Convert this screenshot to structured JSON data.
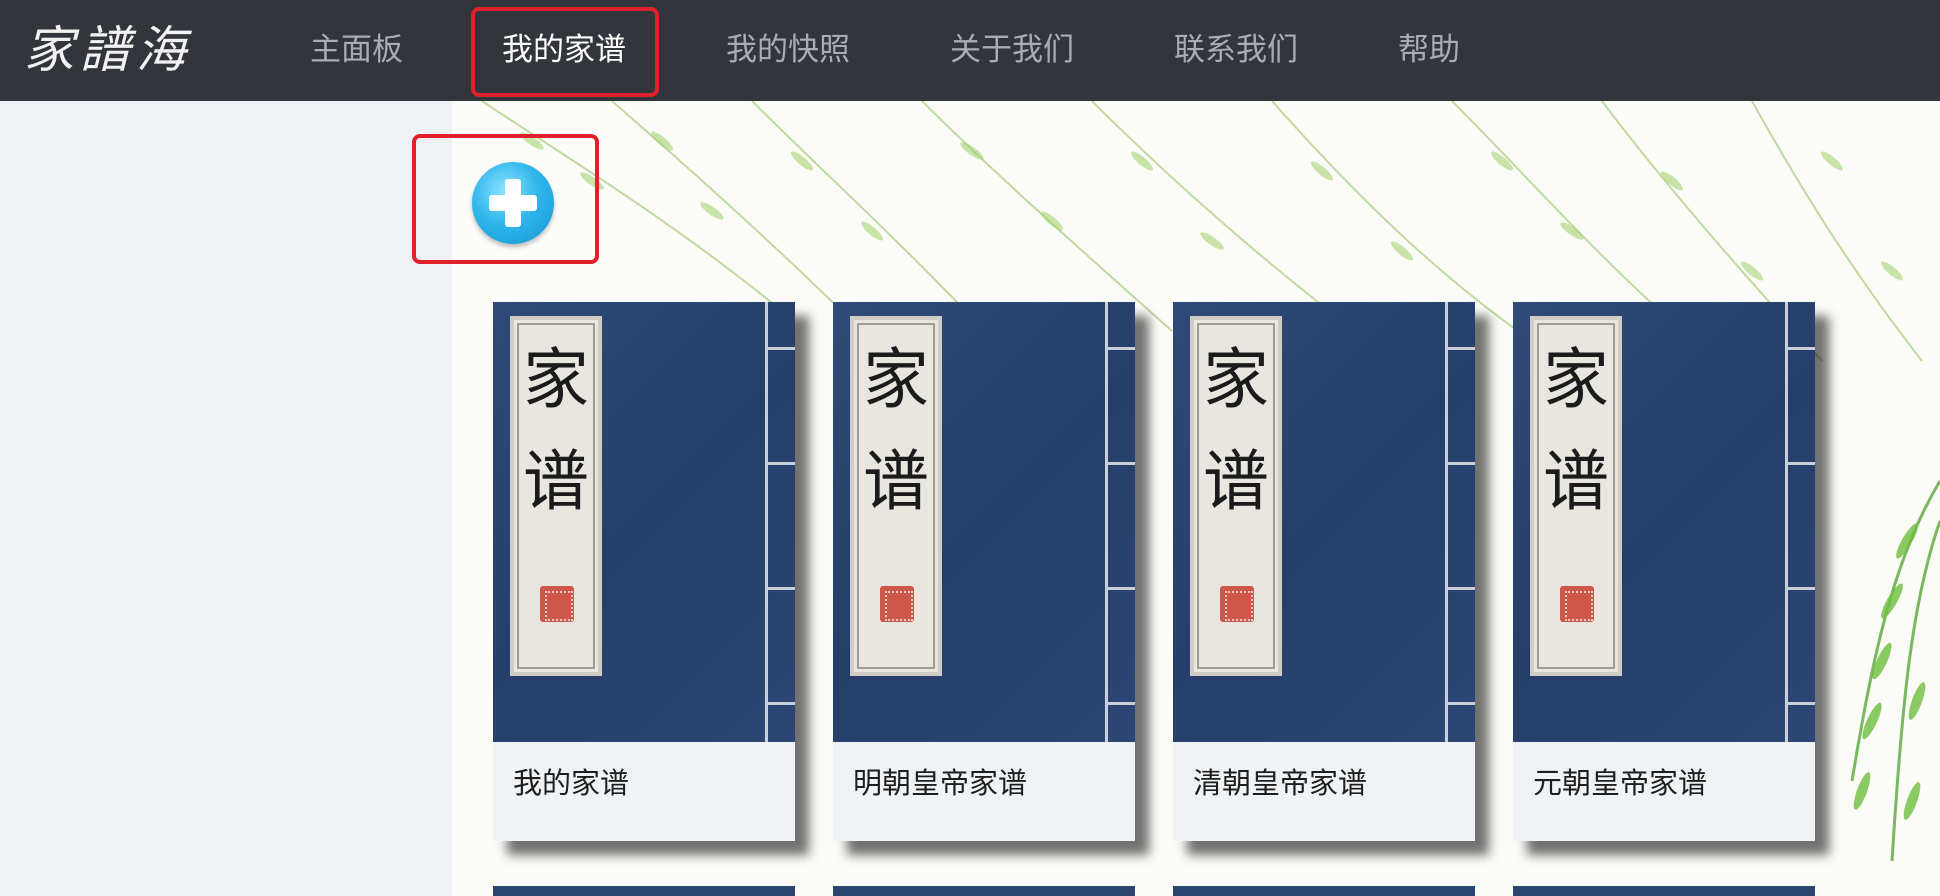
{
  "app": {
    "logo": "家譜海"
  },
  "nav": {
    "items": [
      {
        "label": "主面板"
      },
      {
        "label": "我的家谱",
        "active": true
      },
      {
        "label": "我的快照"
      },
      {
        "label": "关于我们"
      },
      {
        "label": "联系我们"
      },
      {
        "label": "帮助"
      }
    ]
  },
  "actions": {
    "add_icon": "plus-circle-icon"
  },
  "books": [
    {
      "cover_char_1": "家",
      "cover_char_2": "谱",
      "title": "我的家谱"
    },
    {
      "cover_char_1": "家",
      "cover_char_2": "谱",
      "title": "明朝皇帝家谱"
    },
    {
      "cover_char_1": "家",
      "cover_char_2": "谱",
      "title": "清朝皇帝家谱"
    },
    {
      "cover_char_1": "家",
      "cover_char_2": "谱",
      "title": "元朝皇帝家谱"
    }
  ],
  "colors": {
    "topbar": "#32353b",
    "highlight": "#e0202a",
    "cover": "#2a4370",
    "add_button": "#31b7ec"
  }
}
